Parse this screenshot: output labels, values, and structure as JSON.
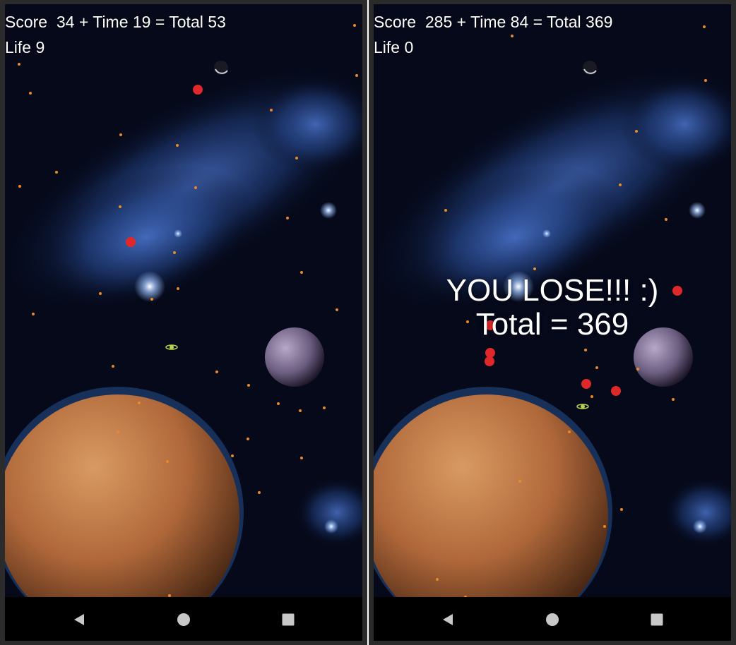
{
  "screens": [
    {
      "id": "left",
      "hud": {
        "score_label": "Score",
        "score": "34",
        "time_label": "Time",
        "time": "19",
        "total_label": "Total",
        "total": "53",
        "score_line": "Score  34 + Time 19 = Total 53",
        "life_line": "Life 9",
        "life": 9
      },
      "game_over": null
    },
    {
      "id": "right",
      "hud": {
        "score_label": "Score",
        "score": "285",
        "time_label": "Time",
        "time": "84",
        "total_label": "Total",
        "total": "369",
        "score_line": "Score  285 + Time 84 = Total 369",
        "life_line": "Life 0",
        "life": 0
      },
      "game_over": {
        "headline": "YOU LOSE!!! :)",
        "total_line": "Total = 369"
      }
    }
  ],
  "nav": {
    "back_icon": "back-triangle-icon",
    "home_icon": "home-circle-icon",
    "recents_icon": "recents-square-icon"
  },
  "colors": {
    "space_bg": "#05091a",
    "nebula": "#3a5fb0",
    "planet": "#c27a45",
    "enemy_ball": "#e0282a",
    "star_dot": "#e88a2a",
    "hud_text": "#ffffff",
    "navbar": "#000000",
    "nav_icon": "#c8c8c8"
  }
}
